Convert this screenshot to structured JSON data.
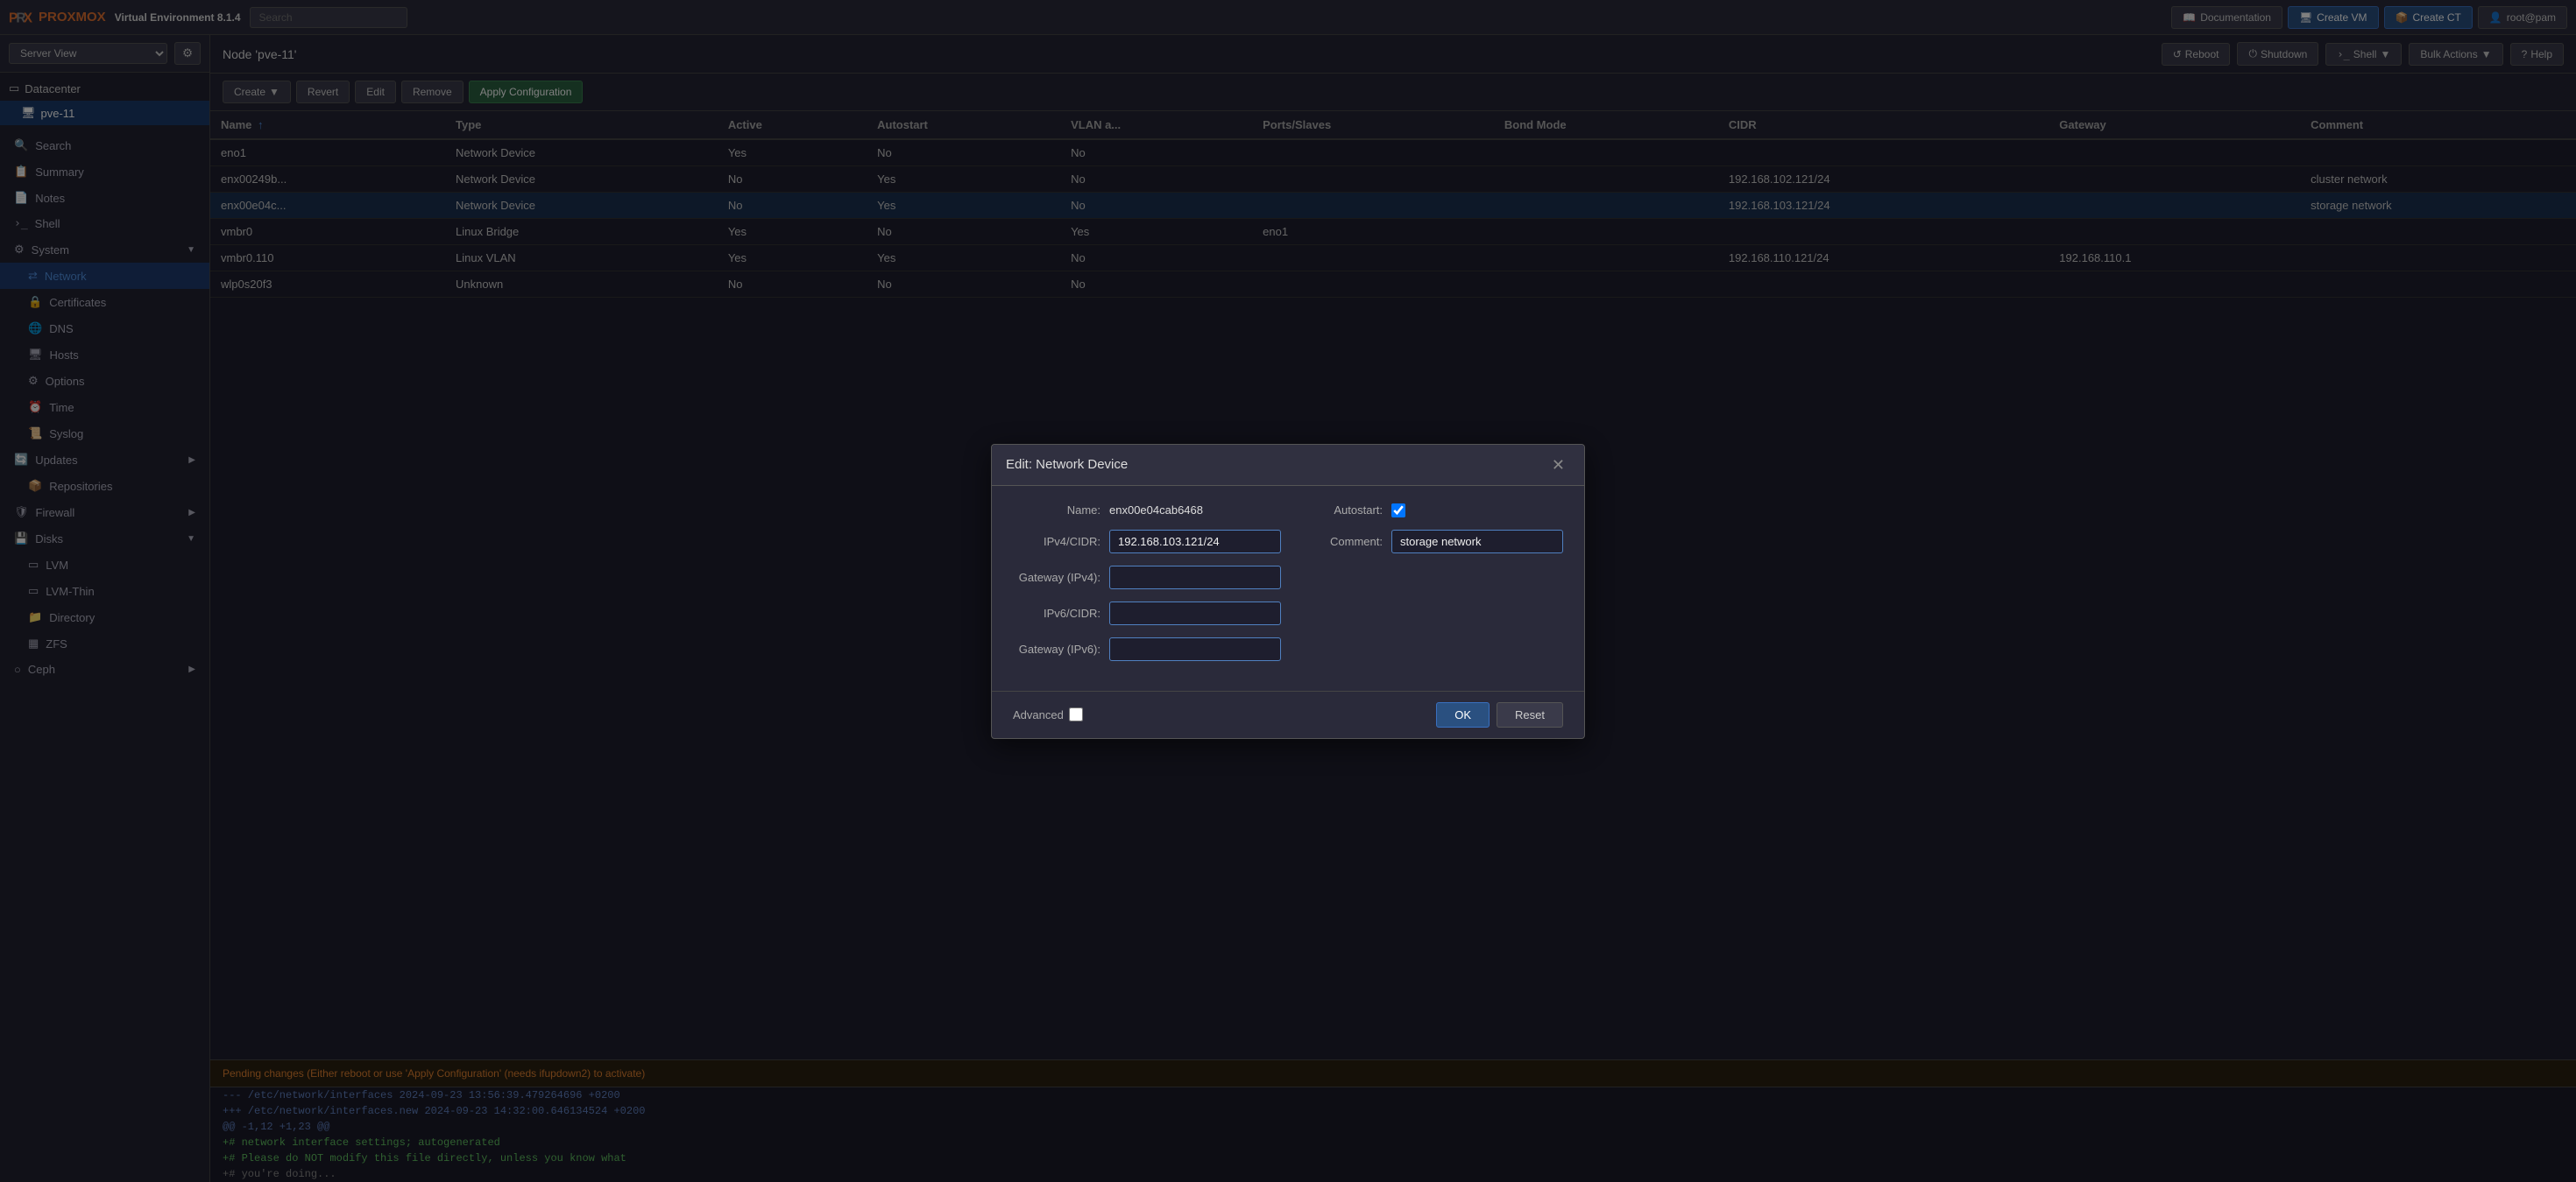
{
  "topbar": {
    "logo_text": "PROXMOX",
    "product": "Virtual Environment 8.1.4",
    "search_placeholder": "Search",
    "buttons": {
      "documentation": "Documentation",
      "create_vm": "Create VM",
      "create_ct": "Create CT",
      "user": "root@pam"
    }
  },
  "sidebar": {
    "server_view_label": "Server View",
    "datacenter_label": "Datacenter",
    "node_label": "pve-11",
    "nav_items": [
      {
        "id": "search",
        "label": "Search",
        "icon": "🔍"
      },
      {
        "id": "summary",
        "label": "Summary",
        "icon": "📋"
      },
      {
        "id": "notes",
        "label": "Notes",
        "icon": "📄"
      },
      {
        "id": "shell",
        "label": "Shell",
        "icon": ">"
      },
      {
        "id": "system",
        "label": "System",
        "icon": "⚙",
        "expandable": true,
        "expanded": true
      },
      {
        "id": "network",
        "label": "Network",
        "icon": "⇄",
        "sub": true,
        "active": true
      },
      {
        "id": "certificates",
        "label": "Certificates",
        "icon": "🔒",
        "sub": true
      },
      {
        "id": "dns",
        "label": "DNS",
        "icon": "🌐",
        "sub": true
      },
      {
        "id": "hosts",
        "label": "Hosts",
        "icon": "🖥",
        "sub": true
      },
      {
        "id": "options",
        "label": "Options",
        "icon": "⚙",
        "sub": true
      },
      {
        "id": "time",
        "label": "Time",
        "icon": "⏰",
        "sub": true
      },
      {
        "id": "syslog",
        "label": "Syslog",
        "icon": "📜",
        "sub": true
      },
      {
        "id": "updates",
        "label": "Updates",
        "icon": "🔄",
        "expandable": true
      },
      {
        "id": "repositories",
        "label": "Repositories",
        "icon": "📦",
        "sub": true
      },
      {
        "id": "firewall",
        "label": "Firewall",
        "icon": "🛡",
        "expandable": true
      },
      {
        "id": "disks",
        "label": "Disks",
        "icon": "💾",
        "expandable": true
      },
      {
        "id": "lvm",
        "label": "LVM",
        "icon": "▭",
        "sub": true
      },
      {
        "id": "lvm-thin",
        "label": "LVM-Thin",
        "icon": "▭",
        "sub": true
      },
      {
        "id": "directory",
        "label": "Directory",
        "icon": "📁",
        "sub": true
      },
      {
        "id": "zfs",
        "label": "ZFS",
        "icon": "▦",
        "sub": true
      },
      {
        "id": "ceph",
        "label": "Ceph",
        "icon": "○",
        "sub": true,
        "expandable": true
      }
    ]
  },
  "content": {
    "node_title": "Node 'pve-11'",
    "header_buttons": {
      "reboot": "Reboot",
      "shutdown": "Shutdown",
      "shell": "Shell",
      "bulk_actions": "Bulk Actions",
      "help": "Help"
    },
    "toolbar": {
      "create": "Create",
      "revert": "Revert",
      "edit": "Edit",
      "remove": "Remove",
      "apply_config": "Apply Configuration"
    },
    "table": {
      "columns": [
        "Name",
        "Type",
        "Active",
        "Autostart",
        "VLAN a...",
        "Ports/Slaves",
        "Bond Mode",
        "CIDR",
        "Gateway",
        "Comment"
      ],
      "rows": [
        {
          "name": "eno1",
          "type": "Network Device",
          "active": "Yes",
          "autostart": "No",
          "vlan": "No",
          "ports": "",
          "bond_mode": "",
          "cidr": "",
          "gateway": "",
          "comment": ""
        },
        {
          "name": "enx00249b...",
          "type": "Network Device",
          "active": "No",
          "autostart": "Yes",
          "vlan": "No",
          "ports": "",
          "bond_mode": "",
          "cidr": "192.168.102.121/24",
          "gateway": "",
          "comment": "cluster network"
        },
        {
          "name": "enx00e04c...",
          "type": "Network Device",
          "active": "No",
          "autostart": "Yes",
          "vlan": "No",
          "ports": "",
          "bond_mode": "",
          "cidr": "192.168.103.121/24",
          "gateway": "",
          "comment": "storage network",
          "selected": true
        },
        {
          "name": "vmbr0",
          "type": "Linux Bridge",
          "active": "Yes",
          "autostart": "No",
          "vlan": "Yes",
          "ports": "eno1",
          "bond_mode": "",
          "cidr": "",
          "gateway": "",
          "comment": ""
        },
        {
          "name": "vmbr0.110",
          "type": "Linux VLAN",
          "active": "Yes",
          "autostart": "Yes",
          "vlan": "No",
          "ports": "",
          "bond_mode": "",
          "cidr": "192.168.110.121/24",
          "gateway": "192.168.110.1",
          "comment": ""
        },
        {
          "name": "wlp0s20f3",
          "type": "Unknown",
          "active": "No",
          "autostart": "No",
          "vlan": "No",
          "ports": "",
          "bond_mode": "",
          "cidr": "",
          "gateway": "",
          "comment": ""
        }
      ]
    },
    "pending_notice": "Pending changes (Either reboot or use 'Apply Configuration' (needs ifupdown2) to activate)",
    "diff_lines": [
      {
        "type": "meta",
        "text": "--- /etc/network/interfaces    2024-09-23 13:56:39.479264696 +0200"
      },
      {
        "type": "meta",
        "text": "+++ /etc/network/interfaces.new 2024-09-23 14:32:00.646134524 +0200"
      },
      {
        "type": "meta",
        "text": "@@ -1,12 +1,23 @@"
      },
      {
        "type": "added",
        "text": "+# network interface settings; autogenerated"
      },
      {
        "type": "added",
        "text": "+# Please do NOT modify this file directly, unless you know what"
      },
      {
        "type": "comment",
        "text": "+# you're doing..."
      }
    ]
  },
  "modal": {
    "title": "Edit: Network Device",
    "fields": {
      "name_label": "Name:",
      "name_value": "enx00e04cab6468",
      "autostart_label": "Autostart:",
      "autostart_checked": true,
      "ipv4_label": "IPv4/CIDR:",
      "ipv4_value": "192.168.103.121/24",
      "comment_label": "Comment:",
      "comment_value": "storage network",
      "gateway_ipv4_label": "Gateway (IPv4):",
      "gateway_ipv4_value": "",
      "ipv6_label": "IPv6/CIDR:",
      "ipv6_value": "",
      "gateway_ipv6_label": "Gateway (IPv6):",
      "gateway_ipv6_value": ""
    },
    "footer": {
      "advanced_label": "Advanced",
      "ok_label": "OK",
      "reset_label": "Reset"
    }
  }
}
